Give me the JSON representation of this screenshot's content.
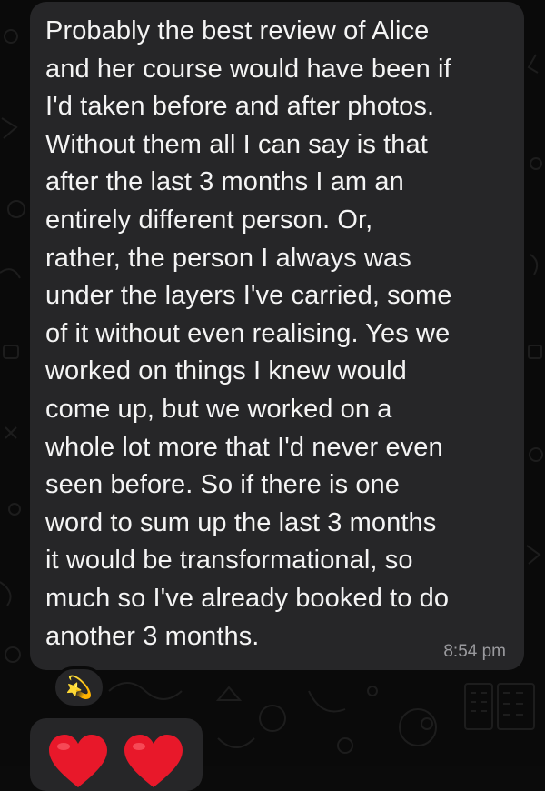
{
  "message": {
    "text": "Probably the best review of Alice\nand her course would have been if\nI'd taken before and after photos.\nWithout them all I can say is that\nafter the last 3 months I am an\nentirely different person.  Or,\nrather, the person I always was\nunder the layers I've carried, some\nof it without even realising.  Yes we\nworked on things I knew would\ncome up, but we worked on a\nwhole lot more that I'd never even\nseen before.  So if there is one\nword to sum up the last 3 months\nit would be transformational, so\nmuch so I've already booked to do\nanother 3 months.",
    "time": "8:54 pm"
  },
  "reaction": {
    "emoji": "💫",
    "icon": "dizzy-star-icon"
  },
  "next_message": {
    "emojis": [
      "❤️",
      "❤️"
    ],
    "icon": "red-heart-icon"
  },
  "colors": {
    "background": "#0a0a0a",
    "bubble": "#262628",
    "text": "#f4f4f4",
    "timestamp": "#9a9a9e",
    "heart": "#e8182a",
    "doodle": "#1c1c1c"
  }
}
